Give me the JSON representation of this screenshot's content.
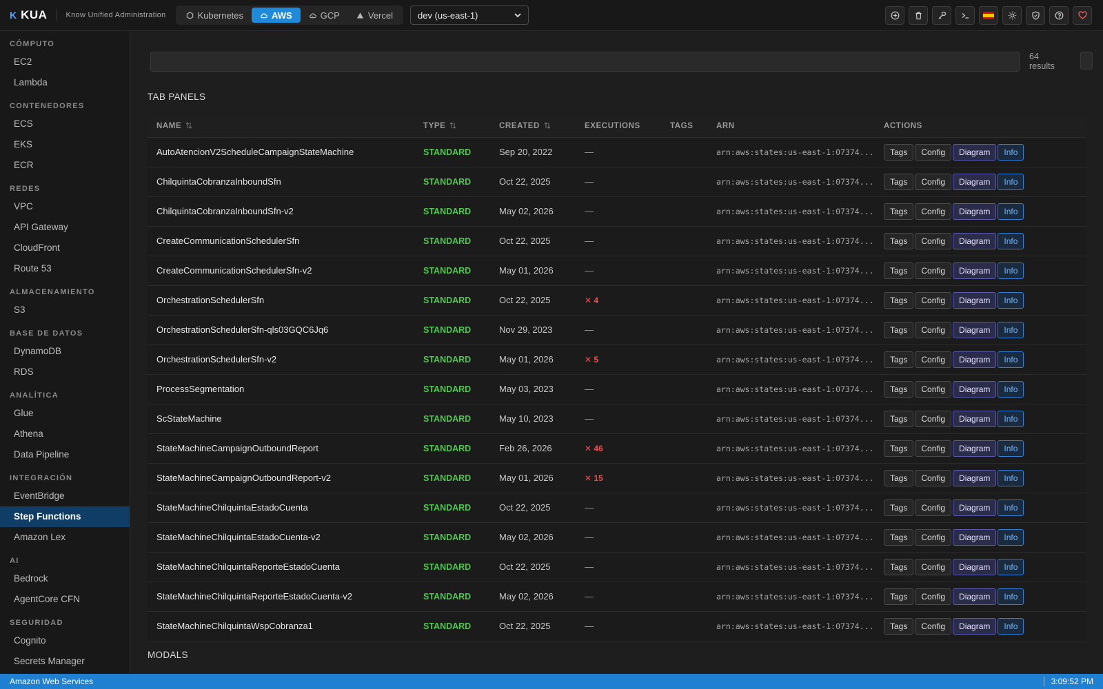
{
  "app": {
    "mark": "K",
    "name": "KUA",
    "subtitle": "Know Unified Administration"
  },
  "providers": [
    {
      "label": "Kubernetes",
      "icon": "kubernetes-icon",
      "active": false
    },
    {
      "label": "AWS",
      "icon": "cloud-icon",
      "active": true
    },
    {
      "label": "GCP",
      "icon": "gcp-cloud-icon",
      "active": false
    },
    {
      "label": "Vercel",
      "icon": "triangle-icon",
      "active": false
    }
  ],
  "region": {
    "selected": "dev (us-east-1)"
  },
  "top_actions": [
    {
      "name": "add-icon"
    },
    {
      "name": "trash-icon"
    },
    {
      "name": "key-icon"
    },
    {
      "name": "terminal-icon"
    },
    {
      "name": "spain-flag-icon"
    },
    {
      "name": "sun-icon"
    },
    {
      "name": "shield-icon"
    },
    {
      "name": "help-icon"
    },
    {
      "name": "heart-icon"
    }
  ],
  "sidebar": {
    "sections": [
      {
        "title": "CÓMPUTO",
        "items": [
          "EC2",
          "Lambda"
        ]
      },
      {
        "title": "CONTENEDORES",
        "items": [
          "ECS",
          "EKS",
          "ECR"
        ]
      },
      {
        "title": "REDES",
        "items": [
          "VPC",
          "API Gateway",
          "CloudFront",
          "Route 53"
        ]
      },
      {
        "title": "ALMACENAMIENTO",
        "items": [
          "S3"
        ]
      },
      {
        "title": "BASE DE DATOS",
        "items": [
          "DynamoDB",
          "RDS"
        ]
      },
      {
        "title": "ANALÍTICA",
        "items": [
          "Glue",
          "Athena",
          "Data Pipeline"
        ]
      },
      {
        "title": "INTEGRACIÓN",
        "items": [
          "EventBridge",
          "Step Functions",
          "Amazon Lex"
        ]
      },
      {
        "title": "AI",
        "items": [
          "Bedrock",
          "AgentCore CFN"
        ]
      },
      {
        "title": "SEGURIDAD",
        "items": [
          "Cognito",
          "Secrets Manager"
        ]
      }
    ],
    "active_item": "Step Functions"
  },
  "search": {
    "value": "",
    "results_count": "64",
    "results_label": "results"
  },
  "sections": {
    "tab_panels": "TAB PANELS",
    "modals": "MODALS"
  },
  "table": {
    "columns": [
      "NAME",
      "TYPE",
      "CREATED",
      "EXECUTIONS",
      "TAGS",
      "ARN",
      "ACTIONS"
    ],
    "action_labels": [
      "Tags",
      "Config",
      "Diagram",
      "Info"
    ],
    "rows": [
      {
        "name": "AutoAtencionV2ScheduleCampaignStateMachine",
        "type": "STANDARD",
        "created": "Sep 20, 2022",
        "executions": "—",
        "tags": "",
        "arn": "arn:aws:states:us-east-1:07374..."
      },
      {
        "name": "ChilquintaCobranzaInboundSfn",
        "type": "STANDARD",
        "created": "Oct 22, 2025",
        "executions": "—",
        "tags": "",
        "arn": "arn:aws:states:us-east-1:07374..."
      },
      {
        "name": "ChilquintaCobranzaInboundSfn-v2",
        "type": "STANDARD",
        "created": "May 02, 2026",
        "executions": "—",
        "tags": "",
        "arn": "arn:aws:states:us-east-1:07374..."
      },
      {
        "name": "CreateCommunicationSchedulerSfn",
        "type": "STANDARD",
        "created": "Oct 22, 2025",
        "executions": "—",
        "tags": "",
        "arn": "arn:aws:states:us-east-1:07374..."
      },
      {
        "name": "CreateCommunicationSchedulerSfn-v2",
        "type": "STANDARD",
        "created": "May 01, 2026",
        "executions": "—",
        "tags": "",
        "arn": "arn:aws:states:us-east-1:07374..."
      },
      {
        "name": "OrchestrationSchedulerSfn",
        "type": "STANDARD",
        "created": "Oct 22, 2025",
        "executions": "✕ 4",
        "tags": "",
        "arn": "arn:aws:states:us-east-1:07374..."
      },
      {
        "name": "OrchestrationSchedulerSfn-qls03GQC6Jq6",
        "type": "STANDARD",
        "created": "Nov 29, 2023",
        "executions": "—",
        "tags": "",
        "arn": "arn:aws:states:us-east-1:07374..."
      },
      {
        "name": "OrchestrationSchedulerSfn-v2",
        "type": "STANDARD",
        "created": "May 01, 2026",
        "executions": "✕ 5",
        "tags": "",
        "arn": "arn:aws:states:us-east-1:07374..."
      },
      {
        "name": "ProcessSegmentation",
        "type": "STANDARD",
        "created": "May 03, 2023",
        "executions": "—",
        "tags": "",
        "arn": "arn:aws:states:us-east-1:07374..."
      },
      {
        "name": "ScStateMachine",
        "type": "STANDARD",
        "created": "May 10, 2023",
        "executions": "—",
        "tags": "",
        "arn": "arn:aws:states:us-east-1:07374..."
      },
      {
        "name": "StateMachineCampaignOutboundReport",
        "type": "STANDARD",
        "created": "Feb 26, 2026",
        "executions": "✕ 46",
        "tags": "",
        "arn": "arn:aws:states:us-east-1:07374..."
      },
      {
        "name": "StateMachineCampaignOutboundReport-v2",
        "type": "STANDARD",
        "created": "May 01, 2026",
        "executions": "✕ 15",
        "tags": "",
        "arn": "arn:aws:states:us-east-1:07374..."
      },
      {
        "name": "StateMachineChilquintaEstadoCuenta",
        "type": "STANDARD",
        "created": "Oct 22, 2025",
        "executions": "—",
        "tags": "",
        "arn": "arn:aws:states:us-east-1:07374..."
      },
      {
        "name": "StateMachineChilquintaEstadoCuenta-v2",
        "type": "STANDARD",
        "created": "May 02, 2026",
        "executions": "—",
        "tags": "",
        "arn": "arn:aws:states:us-east-1:07374..."
      },
      {
        "name": "StateMachineChilquintaReporteEstadoCuenta",
        "type": "STANDARD",
        "created": "Oct 22, 2025",
        "executions": "—",
        "tags": "",
        "arn": "arn:aws:states:us-east-1:07374..."
      },
      {
        "name": "StateMachineChilquintaReporteEstadoCuenta-v2",
        "type": "STANDARD",
        "created": "May 02, 2026",
        "executions": "—",
        "tags": "",
        "arn": "arn:aws:states:us-east-1:07374..."
      },
      {
        "name": "StateMachineChilquintaWspCobranza1",
        "type": "STANDARD",
        "created": "Oct 22, 2025",
        "executions": "—",
        "tags": "",
        "arn": "arn:aws:states:us-east-1:07374..."
      }
    ]
  },
  "statusbar": {
    "left": "Amazon Web Services",
    "clock": "3:09:52 PM"
  },
  "colors": {
    "accent": "#1f8ad9",
    "type_green": "#4ec94e",
    "error_red": "#f14c4c",
    "statusbar": "#1f7fd1"
  }
}
